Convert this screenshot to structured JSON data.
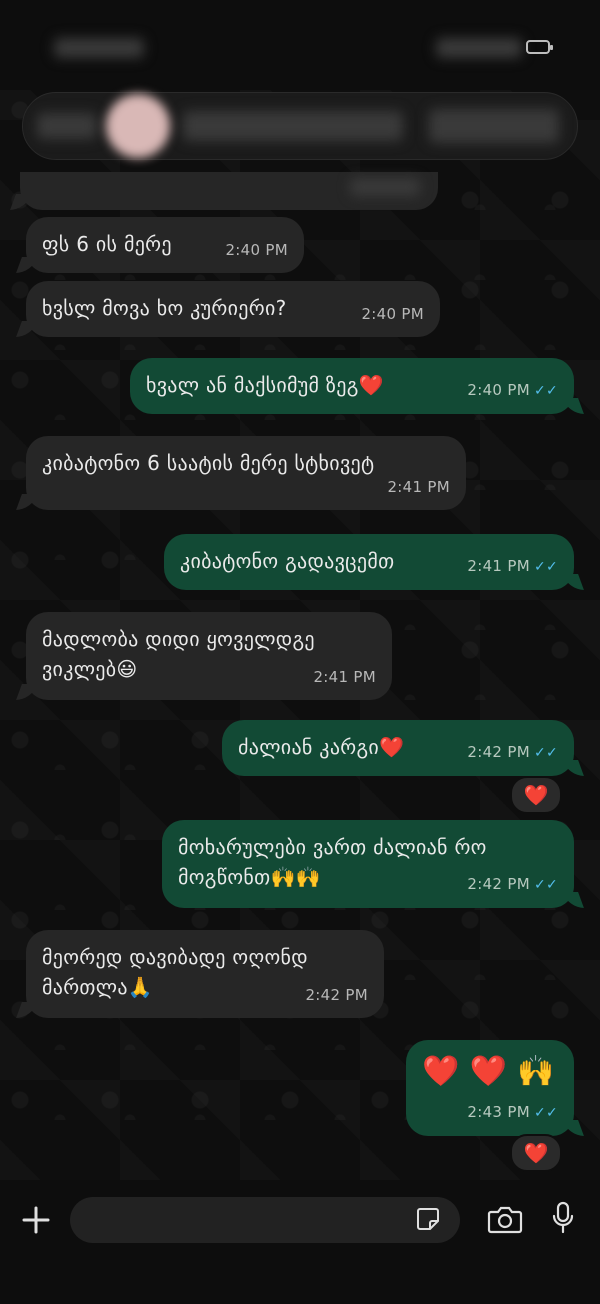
{
  "messages": [
    {
      "text": "ფს 6 ის მერე",
      "time": "2:40 PM",
      "dir": "in"
    },
    {
      "text": "ხვსლ მოვა ხო კურიერი?",
      "time": "2:40 PM",
      "dir": "in"
    },
    {
      "text": "ხვალ ან მაქსიმუმ ზეგ",
      "emoji": "❤️",
      "time": "2:40 PM",
      "dir": "out",
      "ticks": "✓✓"
    },
    {
      "text": "კიბატონო 6 საატის მერე სტხივეტ",
      "time": "2:41 PM",
      "dir": "in"
    },
    {
      "text": "კიბატონო გადავცემთ",
      "time": "2:41 PM",
      "dir": "out",
      "ticks": "✓✓"
    },
    {
      "text": "მადლობა დიდი ყოველდგე ვიკლებ",
      "emoji": "😃",
      "time": "2:41 PM",
      "dir": "in"
    },
    {
      "text": "ძალიან კარგი",
      "emoji": "❤️",
      "time": "2:42 PM",
      "dir": "out",
      "ticks": "✓✓",
      "reaction": "❤️"
    },
    {
      "text": "მოხარულები ვართ ძალიან რო მოგწონთ",
      "emoji": "🙌🙌",
      "time": "2:42 PM",
      "dir": "out",
      "ticks": "✓✓"
    },
    {
      "text": "მეორედ დავიბადე ოღონდ მართლა",
      "emoji": "🙏",
      "time": "2:42 PM",
      "dir": "in"
    },
    {
      "text": "",
      "emoji": "❤️ ❤️ 🙌",
      "time": "2:43 PM",
      "dir": "out",
      "ticks": "✓✓",
      "reaction": "❤️"
    }
  ],
  "icons": {
    "attach": "plus-icon",
    "sticker": "sticker-icon",
    "camera": "camera-icon",
    "mic": "microphone-icon"
  },
  "colors": {
    "incoming": "#262626",
    "outgoing": "#124a35",
    "tick": "#53bdeb"
  }
}
